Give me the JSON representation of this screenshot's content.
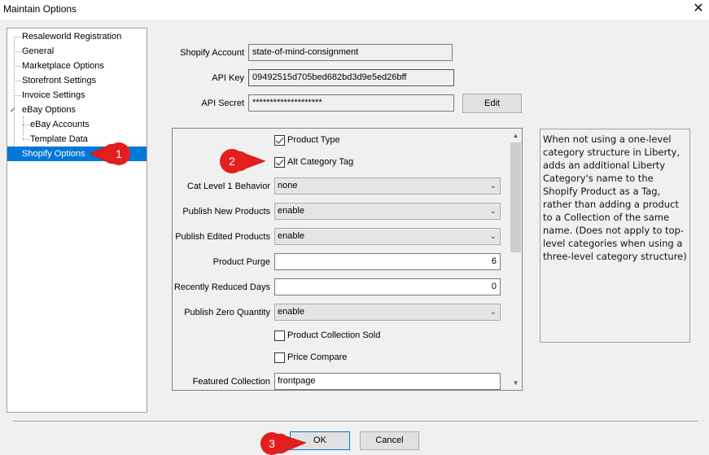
{
  "window": {
    "title": "Maintain Options"
  },
  "tree": {
    "items": [
      {
        "label": "Resaleworld Registration"
      },
      {
        "label": "General"
      },
      {
        "label": "Marketplace Options"
      },
      {
        "label": "Storefront Settings"
      },
      {
        "label": "Invoice Settings"
      },
      {
        "label": "eBay Options"
      },
      {
        "label": "eBay Accounts"
      },
      {
        "label": "Template Data"
      },
      {
        "label": "Shopify Options"
      }
    ],
    "selected": "Shopify Options",
    "expander": "✓"
  },
  "account": {
    "shopify_account_label": "Shopify Account",
    "shopify_account_value": "state-of-mind-consignment",
    "api_key_label": "API Key",
    "api_key_value": "09492515d705bed682bd3d9e5ed26bff",
    "api_secret_label": "API Secret",
    "api_secret_value": "********************",
    "edit_label": "Edit"
  },
  "options": {
    "product_type": {
      "label": "Product Type",
      "checked": true
    },
    "alt_category_tag": {
      "label": "Alt Category Tag",
      "checked": true
    },
    "cat_level_1": {
      "label": "Cat Level 1 Behavior",
      "value": "none"
    },
    "publish_new": {
      "label": "Publish New Products",
      "value": "enable"
    },
    "publish_edited": {
      "label": "Publish Edited Products",
      "value": "enable"
    },
    "product_purge": {
      "label": "Product Purge",
      "value": "6"
    },
    "recently_reduced": {
      "label": "Recently Reduced Days",
      "value": "0"
    },
    "publish_zero": {
      "label": "Publish Zero Quantity",
      "value": "enable"
    },
    "product_collection_sold": {
      "label": "Product Collection Sold",
      "checked": false
    },
    "price_compare": {
      "label": "Price Compare",
      "checked": false
    },
    "featured_collection": {
      "label": "Featured Collection",
      "value": "frontpage"
    }
  },
  "help": {
    "text": "When not using a one-level category structure in Liberty, adds an additional Liberty Category's name to the Shopify Product as a Tag, rather than adding a product to a Collection of the same name. (Does not apply to top-level categories when using a three-level category structure)"
  },
  "footer": {
    "ok_label": "OK",
    "cancel_label": "Cancel"
  },
  "annotations": [
    {
      "number": "1"
    },
    {
      "number": "2"
    },
    {
      "number": "3"
    }
  ],
  "colors": {
    "selection": "#0078d7",
    "badge": "#e31e1e"
  }
}
